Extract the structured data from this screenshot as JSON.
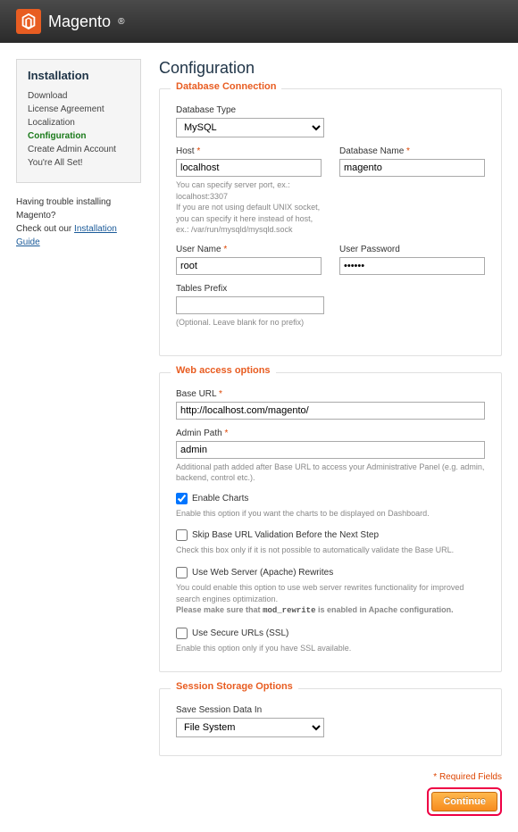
{
  "header": {
    "brand": "Magento"
  },
  "sidebar": {
    "title": "Installation",
    "items": [
      "Download",
      "License Agreement",
      "Localization",
      "Configuration",
      "Create Admin Account",
      "You're All Set!"
    ],
    "active_index": 3
  },
  "help": {
    "line1": "Having trouble installing Magento?",
    "line2_prefix": "Check out our ",
    "link": "Installation Guide"
  },
  "page": {
    "title": "Configuration"
  },
  "db": {
    "legend": "Database Connection",
    "type_label": "Database Type",
    "type_value": "MySQL",
    "host_label": "Host",
    "host_value": "localhost",
    "host_hint": "You can specify server port, ex.: localhost:3307\nIf you are not using default UNIX socket, you can specify it here instead of host, ex.: /var/run/mysqld/mysqld.sock",
    "name_label": "Database Name",
    "name_value": "magento",
    "user_label": "User Name",
    "user_value": "root",
    "pass_label": "User Password",
    "pass_value": "••••••",
    "prefix_label": "Tables Prefix",
    "prefix_value": "",
    "prefix_hint": "(Optional. Leave blank for no prefix)"
  },
  "web": {
    "legend": "Web access options",
    "base_label": "Base URL",
    "base_value": "http://localhost.com/magento/",
    "admin_label": "Admin Path",
    "admin_value": "admin",
    "admin_hint": "Additional path added after Base URL to access your Administrative Panel (e.g. admin, backend, control etc.).",
    "charts_label": "Enable Charts",
    "charts_checked": true,
    "charts_hint": "Enable this option if you want the charts to be displayed on Dashboard.",
    "skip_label": "Skip Base URL Validation Before the Next Step",
    "skip_checked": false,
    "skip_hint": "Check this box only if it is not possible to automatically validate the Base URL.",
    "rewrites_label": "Use Web Server (Apache) Rewrites",
    "rewrites_checked": false,
    "rewrites_hint": "You could enable this option to use web server rewrites functionality for improved search engines optimization.",
    "rewrites_hint2_prefix": "Please make sure that ",
    "rewrites_hint2_code": "mod_rewrite",
    "rewrites_hint2_suffix": " is enabled in Apache configuration.",
    "ssl_label": "Use Secure URLs (SSL)",
    "ssl_checked": false,
    "ssl_hint": "Enable this option only if you have SSL available."
  },
  "session": {
    "legend": "Session Storage Options",
    "save_label": "Save Session Data In",
    "save_value": "File System"
  },
  "footer": {
    "required": "* Required Fields",
    "continue": "Continue"
  }
}
